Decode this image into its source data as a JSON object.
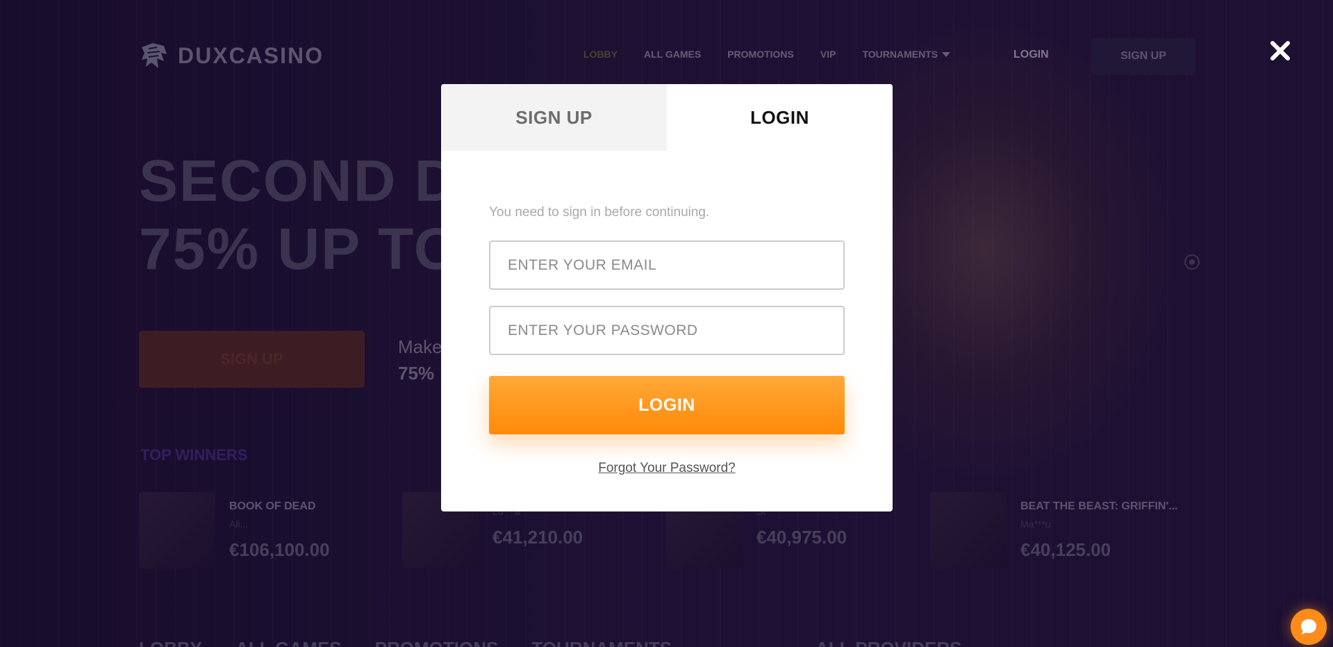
{
  "header": {
    "brand": "DUXCASINO",
    "nav": [
      "LOBBY",
      "ALL GAMES",
      "PROMOTIONS",
      "VIP",
      "TOURNAMENTS"
    ],
    "login_label": "LOGIN",
    "signup_label": "SIGN UP"
  },
  "hero": {
    "line1": "SECOND DE",
    "line2": "75% UP TO",
    "cta_label": "SIGN UP",
    "sub1": "Make",
    "sub2": "75%"
  },
  "winners": {
    "heading": "TOP WINNERS",
    "items": [
      {
        "game": "BOOK OF DEAD",
        "user": "Ali...",
        "amount": "€106,100.00"
      },
      {
        "game": "",
        "user": "Lu***a",
        "amount": "€41,210.00"
      },
      {
        "game": "",
        "user": "St***",
        "amount": "€40,975.00"
      },
      {
        "game": "BEAT THE BEAST: GRIFFIN'...",
        "user": "Ma***u",
        "amount": "€40,125.00"
      }
    ]
  },
  "footer": {
    "nav": [
      "LOBBY",
      "ALL GAMES",
      "PROMOTIONS",
      "TOURNAMENTS"
    ],
    "providers": "ALL PROVIDERS"
  },
  "modal": {
    "tabs": {
      "signup": "SIGN UP",
      "login": "LOGIN"
    },
    "notice": "You need to sign in before continuing.",
    "email_placeholder": "ENTER YOUR EMAIL",
    "password_placeholder": "ENTER YOUR PASSWORD",
    "login_button": "LOGIN",
    "forgot_link": "Forgot Your Password?"
  },
  "icons": {
    "close": "close-icon",
    "chat": "chat-icon",
    "logo": "lion-logo-icon"
  },
  "colors": {
    "accent": "#ff8a08",
    "accent_light": "#ffa938",
    "background": "#1a0e2e"
  }
}
